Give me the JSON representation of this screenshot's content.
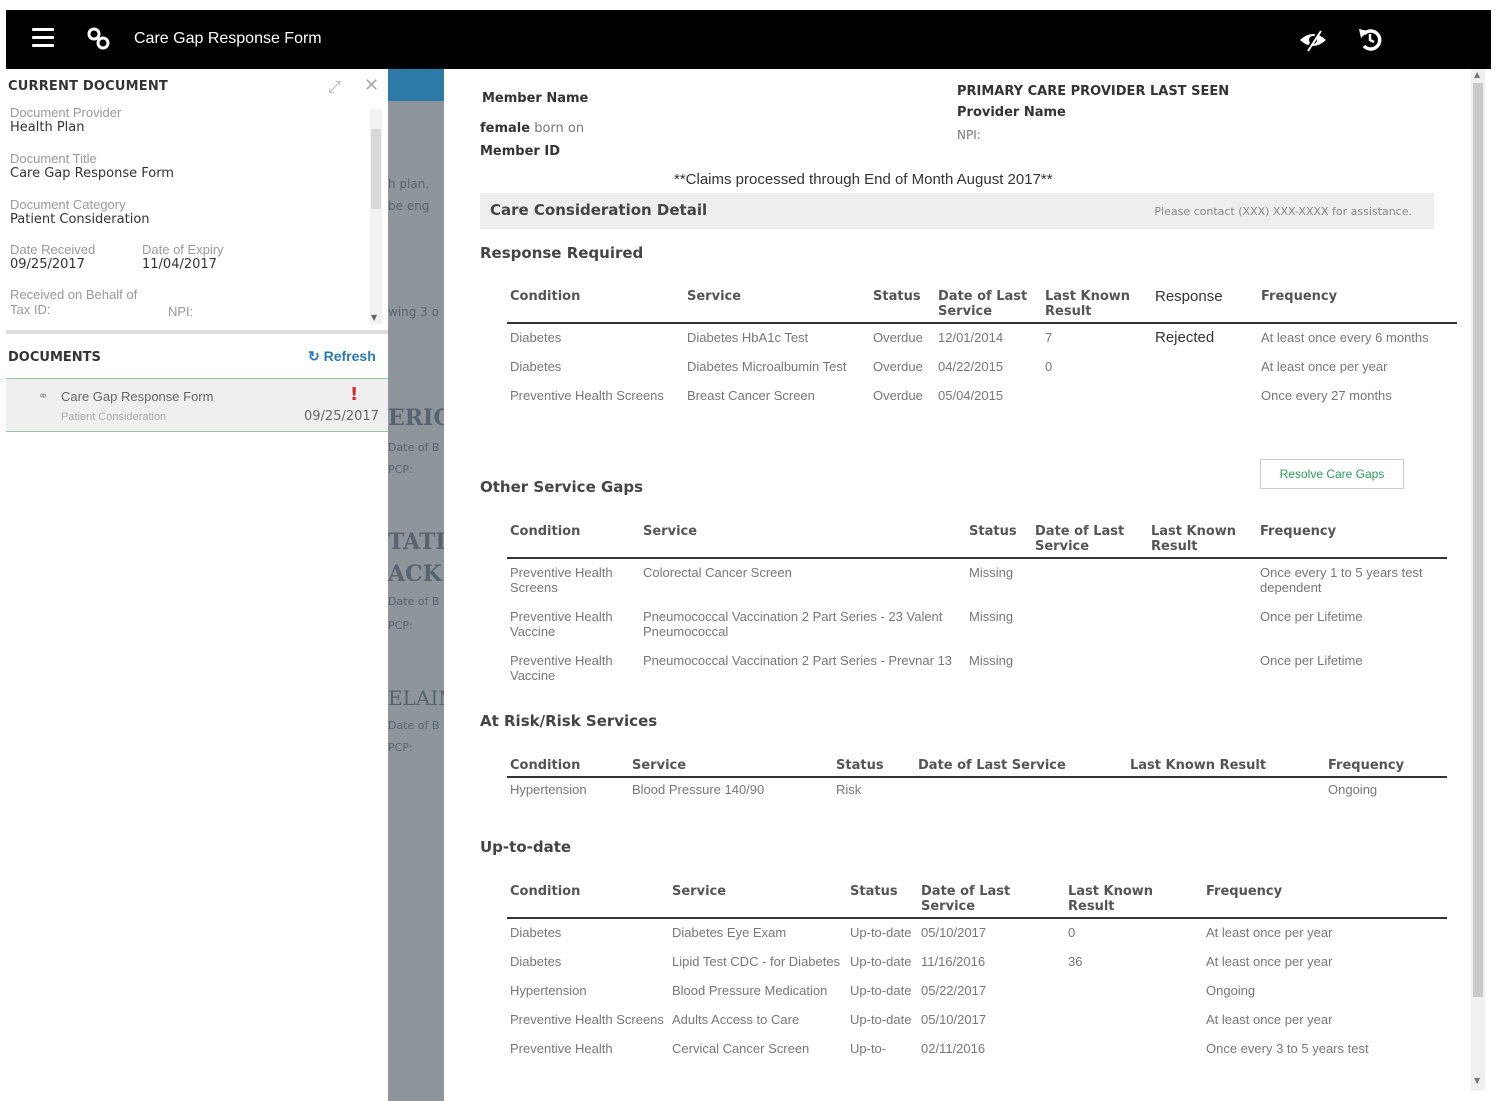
{
  "app": {
    "title": "Care Gap Response Form",
    "menu_icon": "hamburger-icon",
    "link_icon": "link-icon",
    "right_icons": [
      "eye-slash-icon",
      "undo-icon"
    ]
  },
  "current_document": {
    "heading": "CURRENT DOCUMENT",
    "provider_label": "Document Provider",
    "provider_value": "Health Plan",
    "title_label": "Document Title",
    "title_value": "Care Gap Response Form",
    "category_label": "Document Category",
    "category_value": "Patient Consideration",
    "received_label": "Date Received",
    "received_value": "09/25/2017",
    "expiry_label": "Date of Expiry",
    "expiry_value": "11/04/2017",
    "behalf_label": "Received on Behalf of",
    "taxid_label": "Tax ID:",
    "npi_label": "NPI:"
  },
  "documents": {
    "heading": "DOCUMENTS",
    "refresh_label": "Refresh",
    "items": [
      {
        "name": "Care Gap Response Form",
        "category": "Patient Consideration",
        "date": "09/25/2017",
        "flag": "!"
      }
    ]
  },
  "background_fragments": [
    "h plan.",
    "be eng",
    "wing 3 o",
    "ERICA",
    "Date of B",
    "PCP:",
    "TATI",
    "ACK",
    "Date of B",
    "PCP:",
    "ELAIN",
    "Date of B",
    "PCP:"
  ],
  "member": {
    "name_label": "Member Name",
    "gender": "female",
    "born_label": "born on",
    "id_label": "Member ID"
  },
  "provider": {
    "heading": "PRIMARY CARE PROVIDER LAST SEEN",
    "name_label": "Provider Name",
    "npi_label": "NPI:"
  },
  "claims_note": "**Claims processed through End of Month August 2017**",
  "care_detail": {
    "title": "Care Consideration Detail",
    "contact": "Please contact (XXX) XXX-XXXX for assistance."
  },
  "response_required": {
    "heading": "Response Required",
    "columns": [
      "Condition",
      "Service",
      "Status",
      "Date of Last Service",
      "Last Known Result",
      "Response",
      "Frequency"
    ],
    "rows": [
      {
        "condition": "Diabetes",
        "service": "Diabetes HbA1c Test",
        "status": "Overdue",
        "date": "12/01/2014",
        "result": "7",
        "response": "Rejected",
        "frequency": "At least once every 6 months"
      },
      {
        "condition": "Diabetes",
        "service": "Diabetes Microalbumin Test",
        "status": "Overdue",
        "date": "04/22/2015",
        "result": "0",
        "response": "",
        "frequency": "At least once per year"
      },
      {
        "condition": "Preventive Health Screens",
        "service": "Breast Cancer Screen",
        "status": "Overdue",
        "date": "05/04/2015",
        "result": "",
        "response": "",
        "frequency": "Once every 27 months"
      }
    ],
    "resolve_label": "Resolve Care Gaps"
  },
  "other_gaps": {
    "heading": "Other Service Gaps",
    "columns": [
      "Condition",
      "Service",
      "Status",
      "Date of Last Service",
      "Last Known Result",
      "Frequency"
    ],
    "rows": [
      {
        "condition": "Preventive Health Screens",
        "service": "Colorectal Cancer Screen",
        "status": "Missing",
        "date": "",
        "result": "",
        "frequency": "Once every 1 to 5 years test dependent"
      },
      {
        "condition": "Preventive Health Vaccine",
        "service": "Pneumococcal Vaccination 2 Part Series - 23 Valent Pneumococcal",
        "status": "Missing",
        "date": "",
        "result": "",
        "frequency": "Once per Lifetime"
      },
      {
        "condition": "Preventive Health Vaccine",
        "service": "Pneumococcal Vaccination 2 Part Series - Prevnar 13",
        "status": "Missing",
        "date": "",
        "result": "",
        "frequency": "Once per Lifetime"
      }
    ]
  },
  "at_risk": {
    "heading": "At Risk/Risk Services",
    "columns": [
      "Condition",
      "Service",
      "Status",
      "Date of Last Service",
      "Last Known Result",
      "Frequency"
    ],
    "rows": [
      {
        "condition": "Hypertension",
        "service": "Blood Pressure 140/90",
        "status": "Risk",
        "date": "",
        "result": "",
        "frequency": "Ongoing"
      }
    ]
  },
  "up_to_date": {
    "heading": "Up-to-date",
    "columns": [
      "Condition",
      "Service",
      "Status",
      "Date of Last Service",
      "Last Known Result",
      "Frequency"
    ],
    "rows": [
      {
        "condition": "Diabetes",
        "service": "Diabetes Eye Exam",
        "status": "Up-to-date",
        "date": "05/10/2017",
        "result": "0",
        "frequency": "At least once per year"
      },
      {
        "condition": "Diabetes",
        "service": "Lipid Test CDC - for Diabetes",
        "status": "Up-to-date",
        "date": "11/16/2016",
        "result": "36",
        "frequency": "At least once per year"
      },
      {
        "condition": "Hypertension",
        "service": "Blood Pressure Medication",
        "status": "Up-to-date",
        "date": "05/22/2017",
        "result": "",
        "frequency": "Ongoing"
      },
      {
        "condition": "Preventive Health Screens",
        "service": "Adults Access to Care",
        "status": "Up-to-date",
        "date": "05/10/2017",
        "result": "",
        "frequency": "At least once per year"
      },
      {
        "condition": "Preventive Health",
        "service": "Cervical Cancer Screen",
        "status": "Up-to-",
        "date": "02/11/2016",
        "result": "",
        "frequency": "Once every 3 to 5 years test"
      }
    ]
  }
}
